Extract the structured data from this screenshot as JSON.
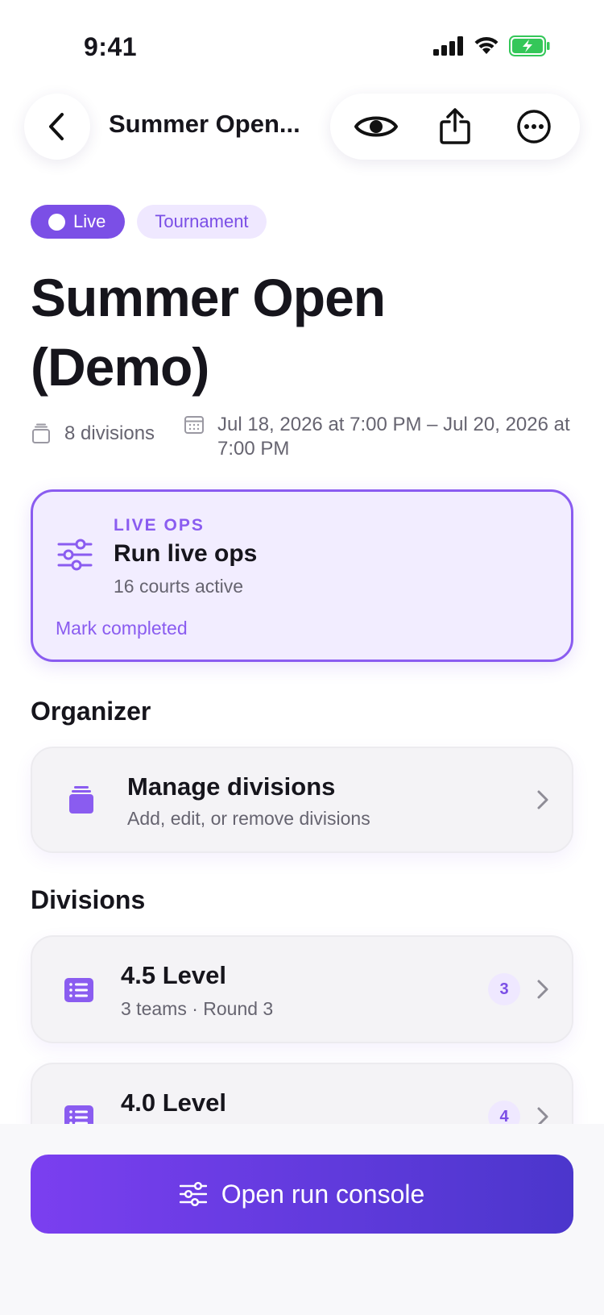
{
  "status_bar": {
    "time": "9:41"
  },
  "nav": {
    "title": "Summer Open..."
  },
  "badges": {
    "live": "Live",
    "type": "Tournament"
  },
  "event": {
    "title_line1": "Summer Open",
    "title_line2": "(Demo)",
    "divisions_count": "8 divisions",
    "date_range": "Jul 18, 2026 at 7:00 PM – Jul 20, 2026 at 7:00 PM"
  },
  "live_ops": {
    "eyebrow": "LIVE OPS",
    "title": "Run live ops",
    "subtitle": "16 courts active",
    "action": "Mark completed"
  },
  "organizer": {
    "heading": "Organizer",
    "manage": {
      "title": "Manage divisions",
      "subtitle": "Add, edit, or remove divisions"
    }
  },
  "divisions": {
    "heading": "Divisions",
    "items": [
      {
        "title": "4.5 Level",
        "subtitle": "3 teams · Round 3",
        "count": "3"
      },
      {
        "title": "4.0 Level",
        "subtitle": "",
        "count": "4"
      }
    ]
  },
  "cta": {
    "label": "Open run console"
  },
  "colors": {
    "accent": "#7b4fe6",
    "accent_light": "#efe8ff",
    "gradient_end": "#4b36cc"
  }
}
